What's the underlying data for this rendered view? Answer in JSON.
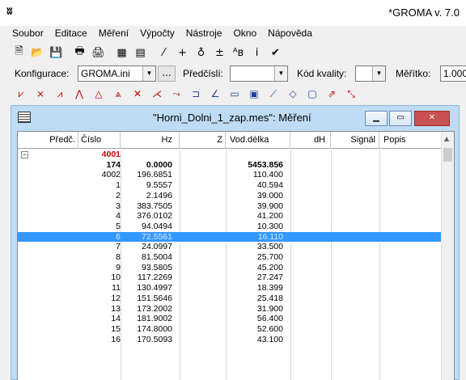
{
  "window": {
    "title": "*GROMA v. 7.0"
  },
  "menu": [
    "Soubor",
    "Editace",
    "Měření",
    "Výpočty",
    "Nástroje",
    "Okno",
    "Nápověda"
  ],
  "toolbar1": [
    {
      "icon": "new-file-icon",
      "glyph": "🗎"
    },
    {
      "icon": "open-folder-icon",
      "glyph": "📂"
    },
    {
      "icon": "save-icon",
      "glyph": "💾"
    },
    {
      "icon": "print-icon",
      "glyph": "🖶"
    },
    {
      "icon": "print-preview-icon",
      "glyph": "🖨"
    },
    {
      "icon": "table-icon",
      "glyph": "▦"
    },
    {
      "icon": "form-icon",
      "glyph": "▤"
    },
    {
      "icon": "measure-icon",
      "glyph": "⁄"
    },
    {
      "icon": "plus-icon",
      "glyph": "+"
    },
    {
      "icon": "instrument-icon",
      "glyph": "♁"
    },
    {
      "icon": "plus-minus-icon",
      "glyph": "±"
    },
    {
      "icon": "ab-icon",
      "glyph": "ᴬʙ"
    },
    {
      "icon": "info-icon",
      "glyph": "i"
    },
    {
      "icon": "check-icon",
      "glyph": "✔"
    }
  ],
  "options": {
    "konfigurace_label": "Konfigurace:",
    "konfigurace_value": "GROMA.ini",
    "dots": "...",
    "predcisli_label": "Předčíslí:",
    "predcisli_value": "",
    "kod_kvality_label": "Kód kvality:",
    "kod_kvality_value": "",
    "meritko_label": "Měřítko:",
    "meritko_value": "1.000"
  },
  "toolbar2": [
    {
      "icon": "polar-icon",
      "glyph": "⩗"
    },
    {
      "icon": "cross-line-icon",
      "glyph": "⨯"
    },
    {
      "icon": "offset-icon",
      "glyph": "⩘"
    },
    {
      "icon": "polygon-icon",
      "glyph": "⋀"
    },
    {
      "icon": "triangle-icon",
      "glyph": "△"
    },
    {
      "icon": "triangle-pair-icon",
      "glyph": "⩓"
    },
    {
      "icon": "intersection-icon",
      "glyph": "✕"
    },
    {
      "icon": "polyline-icon",
      "glyph": "⋌"
    },
    {
      "icon": "traverse-icon",
      "glyph": "⤳"
    },
    {
      "icon": "bracket-icon",
      "glyph": "⊐"
    },
    {
      "icon": "angle-icon",
      "glyph": "∠"
    },
    {
      "icon": "rect-icon",
      "glyph": "▭"
    },
    {
      "icon": "frame-icon",
      "glyph": "▣"
    },
    {
      "icon": "slope-icon",
      "glyph": "⟋"
    },
    {
      "icon": "cube-icon",
      "glyph": "◇"
    },
    {
      "icon": "box-icon",
      "glyph": "▢"
    },
    {
      "icon": "transform-icon",
      "glyph": "⇗"
    },
    {
      "icon": "scale-icon",
      "glyph": "⤡"
    }
  ],
  "child": {
    "title": "\"Horni_Dolni_1_zap.mes\": Měření",
    "minimize": "▁",
    "maximize": "▭",
    "close": "✕"
  },
  "table": {
    "headers": [
      "Předč.",
      "Číslo",
      "Hz",
      "Z",
      "Vod.délka",
      "dH",
      "Signál",
      "Popis"
    ],
    "expander": "−",
    "rows": [
      {
        "predc": "",
        "cislo": "4001",
        "hz": "",
        "z": "",
        "vod": "",
        "style": "red"
      },
      {
        "predc": "",
        "cislo": "174",
        "hz": "0.0000",
        "z": "",
        "vod": "5453.856",
        "style": "bold"
      },
      {
        "predc": "",
        "cislo": "4002",
        "hz": "196.6851",
        "z": "",
        "vod": "110.400",
        "style": ""
      },
      {
        "predc": "",
        "cislo": "1",
        "hz": "9.5557",
        "z": "",
        "vod": "40.594",
        "style": ""
      },
      {
        "predc": "",
        "cislo": "2",
        "hz": "2.1496",
        "z": "",
        "vod": "39.000",
        "style": ""
      },
      {
        "predc": "",
        "cislo": "3",
        "hz": "383.7505",
        "z": "",
        "vod": "39.900",
        "style": ""
      },
      {
        "predc": "",
        "cislo": "4",
        "hz": "376.0102",
        "z": "",
        "vod": "41.200",
        "style": ""
      },
      {
        "predc": "",
        "cislo": "5",
        "hz": "94.0494",
        "z": "",
        "vod": "10.300",
        "style": ""
      },
      {
        "predc": "",
        "cislo": "6",
        "hz": "72.5561",
        "z": "",
        "vod": "16.110",
        "style": "sel"
      },
      {
        "predc": "",
        "cislo": "7",
        "hz": "24.0997",
        "z": "",
        "vod": "33.500",
        "style": ""
      },
      {
        "predc": "",
        "cislo": "8",
        "hz": "81.5004",
        "z": "",
        "vod": "25.700",
        "style": ""
      },
      {
        "predc": "",
        "cislo": "9",
        "hz": "93.5805",
        "z": "",
        "vod": "45.200",
        "style": ""
      },
      {
        "predc": "",
        "cislo": "10",
        "hz": "117.2269",
        "z": "",
        "vod": "27.247",
        "style": ""
      },
      {
        "predc": "",
        "cislo": "11",
        "hz": "130.4997",
        "z": "",
        "vod": "18.399",
        "style": ""
      },
      {
        "predc": "",
        "cislo": "12",
        "hz": "151.5646",
        "z": "",
        "vod": "25.418",
        "style": ""
      },
      {
        "predc": "",
        "cislo": "13",
        "hz": "173.2002",
        "z": "",
        "vod": "31.900",
        "style": ""
      },
      {
        "predc": "",
        "cislo": "14",
        "hz": "181.9002",
        "z": "",
        "vod": "56.400",
        "style": ""
      },
      {
        "predc": "",
        "cislo": "15",
        "hz": "174.8000",
        "z": "",
        "vod": "52.600",
        "style": ""
      },
      {
        "predc": "",
        "cislo": "16",
        "hz": "170.5093",
        "z": "",
        "vod": "43.100",
        "style": ""
      }
    ]
  },
  "colors": {
    "selection": "#3399ff",
    "station": "#d00000",
    "mdi_frame": "#bfdcf6"
  }
}
